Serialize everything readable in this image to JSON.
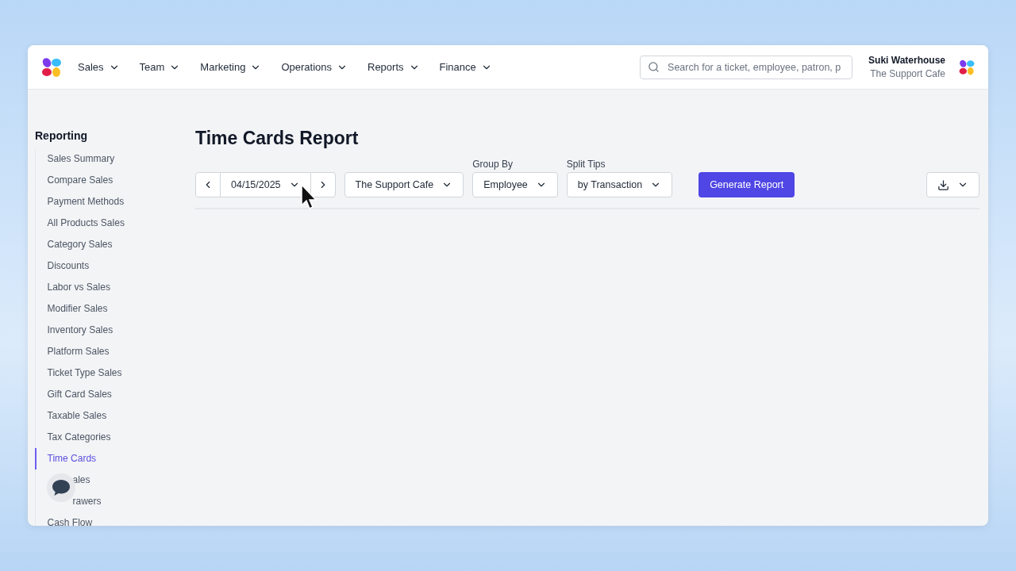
{
  "nav": {
    "menus": [
      {
        "label": "Sales"
      },
      {
        "label": "Team"
      },
      {
        "label": "Marketing"
      },
      {
        "label": "Operations"
      },
      {
        "label": "Reports"
      },
      {
        "label": "Finance"
      }
    ],
    "search": {
      "placeholder": "Search for a ticket, employee, patron, p"
    },
    "user": {
      "name": "Suki Waterhouse",
      "venue": "The Support Cafe"
    }
  },
  "sidebar": {
    "title": "Reporting",
    "items": [
      {
        "label": "Sales Summary",
        "selected": false
      },
      {
        "label": "Compare Sales",
        "selected": false
      },
      {
        "label": "Payment Methods",
        "selected": false
      },
      {
        "label": "All Products Sales",
        "selected": false
      },
      {
        "label": "Category Sales",
        "selected": false
      },
      {
        "label": "Discounts",
        "selected": false
      },
      {
        "label": "Labor vs Sales",
        "selected": false
      },
      {
        "label": "Modifier Sales",
        "selected": false
      },
      {
        "label": "Inventory Sales",
        "selected": false
      },
      {
        "label": "Platform Sales",
        "selected": false
      },
      {
        "label": "Ticket Type Sales",
        "selected": false
      },
      {
        "label": "Gift Card Sales",
        "selected": false
      },
      {
        "label": "Taxable Sales",
        "selected": false
      },
      {
        "label": "Tax Categories",
        "selected": false
      },
      {
        "label": "Time Cards",
        "selected": true
      },
      {
        "label": "ales",
        "selected": false,
        "kind": "covered"
      },
      {
        "label": "rawers",
        "selected": false,
        "kind": "covered"
      },
      {
        "label": "Cash Flow",
        "selected": false
      }
    ]
  },
  "report": {
    "title": "Time Cards Report",
    "date": "04/15/2025",
    "venue": "The Support Cafe",
    "group_by": {
      "label": "Group By",
      "value": "Employee"
    },
    "split_tips": {
      "label": "Split Tips",
      "value": "by Transaction"
    },
    "generate": "Generate Report"
  }
}
